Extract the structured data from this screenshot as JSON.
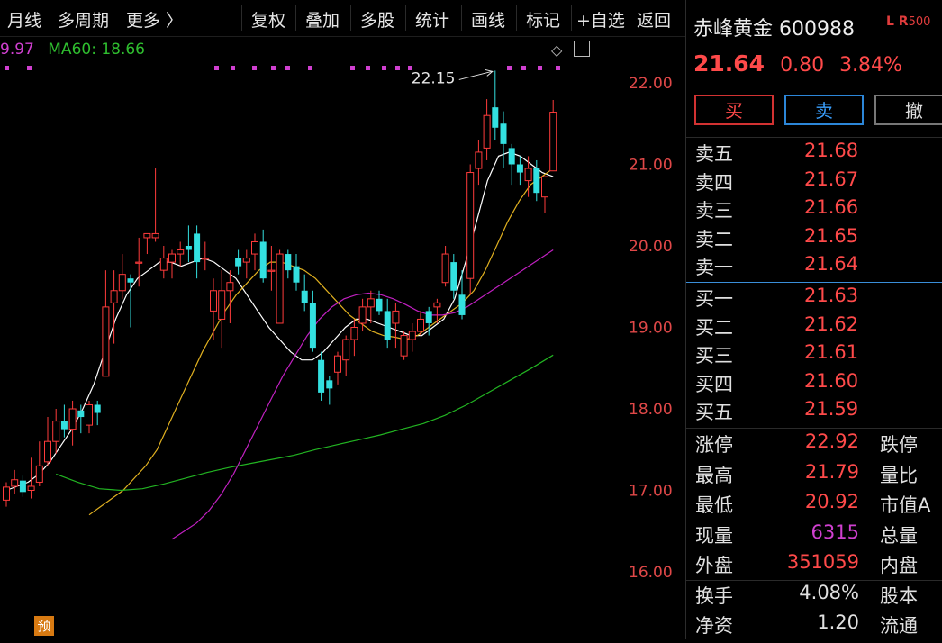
{
  "toolbar": {
    "items": [
      "月线",
      "多周期",
      "更多 〉",
      "复权",
      "叠加",
      "多股",
      "统计",
      "画线",
      "标记",
      "+自选",
      "返回"
    ]
  },
  "legend": {
    "ma_prev": "9.97",
    "ma60": "MA60: 18.66",
    "ma_prev_color": "#d040d0",
    "ma60_color": "#2fbe2f"
  },
  "chart_data": {
    "type": "candlestick",
    "title": "",
    "ylim": [
      15.6,
      22.6
    ],
    "y_ticks": [
      "22.00",
      "21.00",
      "20.00",
      "19.00",
      "18.00",
      "17.00",
      "16.00"
    ],
    "y_tick_values": [
      22,
      21,
      20,
      19,
      18,
      17,
      16
    ],
    "high_annotation": "22.15",
    "up_color": "#ff3b3b",
    "down_color": "#33e0e0",
    "candles": [
      [
        16.88,
        17.1,
        16.8,
        17.04
      ],
      [
        17.05,
        17.25,
        16.95,
        17.13
      ],
      [
        17.12,
        17.18,
        16.92,
        16.98
      ],
      [
        17.0,
        17.4,
        16.9,
        17.05
      ],
      [
        17.1,
        17.6,
        17.05,
        17.3
      ],
      [
        17.35,
        17.9,
        17.3,
        17.6
      ],
      [
        17.6,
        18.0,
        17.45,
        17.85
      ],
      [
        17.85,
        18.05,
        17.65,
        17.75
      ],
      [
        17.75,
        18.1,
        17.55,
        18.0
      ],
      [
        17.98,
        18.05,
        17.7,
        17.9
      ],
      [
        17.8,
        18.1,
        17.7,
        18.05
      ],
      [
        18.05,
        18.1,
        17.8,
        17.95
      ],
      [
        18.4,
        19.7,
        18.4,
        19.25
      ],
      [
        19.3,
        19.7,
        18.8,
        19.45
      ],
      [
        19.45,
        19.9,
        19.35,
        19.65
      ],
      [
        19.6,
        19.65,
        19.0,
        19.55
      ],
      [
        19.8,
        20.1,
        19.5,
        19.8
      ],
      [
        20.1,
        20.1,
        19.9,
        20.15
      ],
      [
        20.1,
        20.95,
        20.05,
        20.15
      ],
      [
        19.7,
        20.0,
        19.6,
        19.85
      ],
      [
        19.8,
        19.95,
        19.6,
        19.9
      ],
      [
        19.9,
        20.05,
        19.75,
        19.95
      ],
      [
        20.0,
        20.25,
        19.8,
        19.95
      ],
      [
        20.15,
        20.25,
        19.6,
        19.8
      ],
      [
        19.85,
        20.05,
        19.7,
        19.85
      ],
      [
        19.2,
        19.6,
        18.85,
        19.45
      ],
      [
        19.1,
        19.7,
        18.75,
        19.45
      ],
      [
        19.45,
        19.7,
        19.05,
        19.55
      ],
      [
        19.85,
        19.95,
        19.65,
        19.75
      ],
      [
        19.8,
        19.95,
        19.6,
        19.85
      ],
      [
        19.9,
        20.15,
        19.7,
        20.05
      ],
      [
        20.05,
        20.2,
        19.55,
        19.6
      ],
      [
        19.7,
        20.0,
        19.45,
        19.7
      ],
      [
        19.05,
        19.95,
        19.05,
        19.9
      ],
      [
        19.9,
        19.95,
        19.6,
        19.7
      ],
      [
        19.75,
        19.9,
        19.45,
        19.55
      ],
      [
        19.45,
        19.65,
        19.2,
        19.3
      ],
      [
        19.3,
        19.45,
        18.7,
        18.75
      ],
      [
        18.6,
        18.7,
        18.1,
        18.2
      ],
      [
        18.35,
        18.4,
        18.05,
        18.25
      ],
      [
        18.45,
        18.7,
        18.3,
        18.65
      ],
      [
        18.6,
        18.9,
        18.4,
        18.85
      ],
      [
        18.85,
        19.1,
        18.65,
        19.0
      ],
      [
        19.05,
        19.35,
        18.95,
        19.25
      ],
      [
        19.25,
        19.45,
        19.05,
        19.35
      ],
      [
        19.35,
        19.45,
        19.15,
        19.2
      ],
      [
        19.2,
        19.35,
        18.75,
        18.85
      ],
      [
        19.05,
        19.3,
        18.75,
        19.2
      ],
      [
        18.65,
        18.95,
        18.6,
        18.9
      ],
      [
        18.85,
        19.05,
        18.7,
        18.95
      ],
      [
        18.95,
        19.2,
        18.9,
        19.1
      ],
      [
        19.2,
        19.25,
        18.9,
        19.05
      ],
      [
        19.25,
        19.35,
        19.05,
        19.3
      ],
      [
        19.55,
        20.0,
        19.5,
        19.9
      ],
      [
        19.8,
        19.9,
        19.35,
        19.45
      ],
      [
        19.4,
        19.7,
        19.1,
        19.15
      ],
      [
        19.6,
        21.0,
        19.4,
        20.9
      ],
      [
        20.95,
        21.3,
        20.75,
        21.15
      ],
      [
        21.2,
        21.8,
        21.05,
        21.6
      ],
      [
        21.7,
        22.15,
        21.3,
        21.45
      ],
      [
        21.5,
        21.65,
        20.95,
        21.25
      ],
      [
        21.2,
        21.25,
        20.75,
        21.0
      ],
      [
        21.0,
        21.1,
        20.75,
        20.9
      ],
      [
        20.8,
        21.1,
        20.6,
        20.95
      ],
      [
        20.95,
        21.05,
        20.55,
        20.65
      ],
      [
        20.6,
        20.85,
        20.4,
        20.85
      ],
      [
        20.92,
        21.79,
        20.92,
        21.64
      ]
    ],
    "series": [
      {
        "color": "#ffffff",
        "values": [
          17.0,
          17.05,
          17.1,
          17.2,
          17.35,
          17.55,
          17.75,
          18.0,
          18.3,
          18.7,
          19.1,
          19.4,
          19.6,
          19.7,
          19.8,
          19.8,
          19.75,
          19.8,
          19.85,
          19.8,
          19.7,
          19.6,
          19.4,
          19.2,
          19.0,
          18.85,
          18.7,
          18.6,
          18.6,
          18.7,
          18.85,
          19.0,
          19.1,
          19.1,
          19.05,
          19.0,
          18.95,
          18.9,
          18.9,
          19.0,
          19.1,
          19.35,
          19.8,
          20.3,
          20.8,
          21.1,
          21.15,
          21.1,
          21.0,
          20.9,
          20.85
        ]
      },
      {
        "color": "#e0b020",
        "values": [
          16.7,
          16.8,
          16.9,
          17.0,
          17.15,
          17.3,
          17.5,
          17.8,
          18.1,
          18.4,
          18.7,
          18.95,
          19.2,
          19.4,
          19.55,
          19.7,
          19.8,
          19.8,
          19.75,
          19.7,
          19.6,
          19.45,
          19.3,
          19.15,
          19.05,
          18.95,
          18.9,
          18.88,
          18.85,
          18.9,
          19.0,
          19.1,
          19.2,
          19.3,
          19.45,
          19.7,
          20.0,
          20.3,
          20.55,
          20.75,
          20.85,
          20.95
        ]
      },
      {
        "color": "#c020c0",
        "values": [
          16.4,
          16.5,
          16.6,
          16.75,
          16.95,
          17.2,
          17.5,
          17.8,
          18.1,
          18.4,
          18.65,
          18.9,
          19.1,
          19.25,
          19.35,
          19.4,
          19.42,
          19.4,
          19.35,
          19.28,
          19.2,
          19.15,
          19.15,
          19.18,
          19.25,
          19.35,
          19.45,
          19.55,
          19.65,
          19.75,
          19.85,
          19.95
        ]
      },
      {
        "color": "#22b422",
        "values": [
          17.2,
          17.1,
          17.02,
          17.0,
          17.02,
          17.08,
          17.15,
          17.22,
          17.28,
          17.33,
          17.38,
          17.43,
          17.5,
          17.56,
          17.62,
          17.68,
          17.75,
          17.82,
          17.92,
          18.05,
          18.2,
          18.35,
          18.5,
          18.66
        ]
      }
    ]
  },
  "stock": {
    "name_code": "赤峰黄金 600988",
    "badge": "L R",
    "badge_num": "500",
    "price": "21.64",
    "change": "0.80",
    "pct": "3.84%"
  },
  "buttons": {
    "buy": "买",
    "sell": "卖",
    "cancel": "撤"
  },
  "orderbook": {
    "asks": [
      {
        "label": "卖五",
        "price": "21.68"
      },
      {
        "label": "卖四",
        "price": "21.67"
      },
      {
        "label": "卖三",
        "price": "21.66"
      },
      {
        "label": "卖二",
        "price": "21.65"
      },
      {
        "label": "卖一",
        "price": "21.64"
      }
    ],
    "bids": [
      {
        "label": "买一",
        "price": "21.63"
      },
      {
        "label": "买二",
        "price": "21.62"
      },
      {
        "label": "买三",
        "price": "21.61"
      },
      {
        "label": "买四",
        "price": "21.60"
      },
      {
        "label": "买五",
        "price": "21.59"
      }
    ]
  },
  "stats": [
    {
      "l1": "涨停",
      "v": "22.92",
      "c": "#ff4a4a",
      "l2": "跌停"
    },
    {
      "l1": "最高",
      "v": "21.79",
      "c": "#ff4a4a",
      "l2": "量比"
    },
    {
      "l1": "最低",
      "v": "20.92",
      "c": "#ff4a4a",
      "l2": "市值A"
    },
    {
      "l1": "现量",
      "v": "6315",
      "c": "#d040d0",
      "l2": "总量"
    },
    {
      "l1": "外盘",
      "v": "351059",
      "c": "#ff4a4a",
      "l2": "内盘"
    },
    {
      "l1": "换手",
      "v": "4.08%",
      "c": "#e0e0e0",
      "l2": "股本"
    },
    {
      "l1": "净资",
      "v": "1.20",
      "c": "#e0e0e0",
      "l2": "流通"
    }
  ],
  "badge_yu": "预"
}
